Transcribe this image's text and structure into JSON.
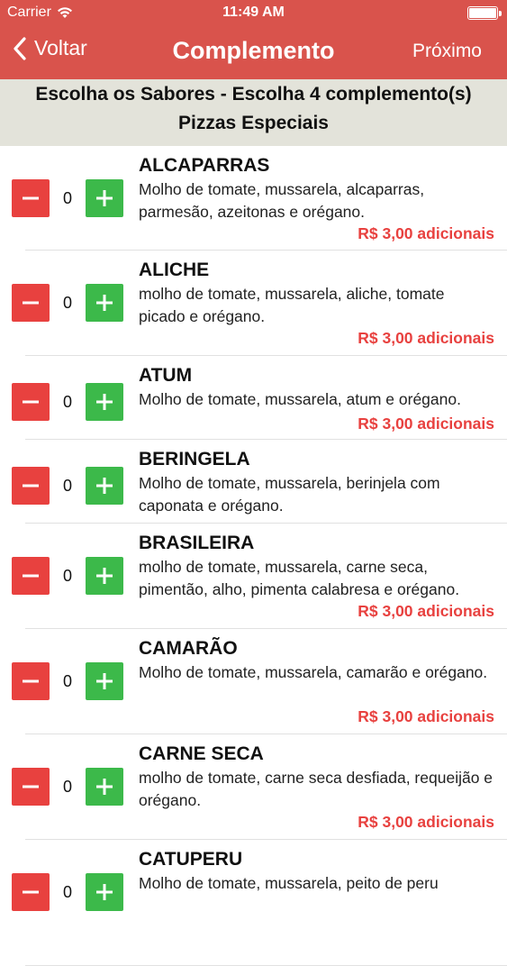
{
  "status_bar": {
    "carrier": "Carrier",
    "time": "11:49 AM"
  },
  "nav": {
    "back_label": "Voltar",
    "title": "Complemento",
    "next_label": "Próximo"
  },
  "subheader": {
    "line1": "Escolha os Sabores - Escolha 4 complemento(s)",
    "line2": "Pizzas Especiais"
  },
  "items": [
    {
      "name": "ALCAPARRAS",
      "desc": "Molho de tomate, mussarela, alcaparras, parmesão, azeitonas e orégano.",
      "qty": "0",
      "price": "R$ 3,00 adicionais"
    },
    {
      "name": "ALICHE",
      "desc": "molho de tomate, mussarela, aliche, tomate picado e orégano.",
      "qty": "0",
      "price": "R$ 3,00 adicionais"
    },
    {
      "name": "ATUM",
      "desc": "Molho de tomate, mussarela, atum e orégano.",
      "qty": "0",
      "price": "R$ 3,00 adicionais"
    },
    {
      "name": "BERINGELA",
      "desc": "Molho de tomate, mussarela, berinjela com caponata e orégano.",
      "qty": "0",
      "price": ""
    },
    {
      "name": "BRASILEIRA",
      "desc": "molho de tomate, mussarela, carne seca, pimentão, alho, pimenta calabresa e orégano.",
      "qty": "0",
      "price": "R$ 3,00 adicionais"
    },
    {
      "name": "CAMARÃO",
      "desc": "Molho de tomate, mussarela, camarão e orégano.",
      "qty": "0",
      "price": "R$ 3,00 adicionais"
    },
    {
      "name": "CARNE SECA",
      "desc": "molho de tomate, carne seca desfiada, requeijão e orégano.",
      "qty": "0",
      "price": "R$ 3,00 adicionais"
    },
    {
      "name": "CATUPERU",
      "desc": "Molho de tomate, mussarela, peito de peru",
      "qty": "0",
      "price": ""
    }
  ],
  "colors": {
    "nav_bg": "#d9534c",
    "minus": "#e8413f",
    "plus": "#3cb94a",
    "price": "#e8413f"
  }
}
